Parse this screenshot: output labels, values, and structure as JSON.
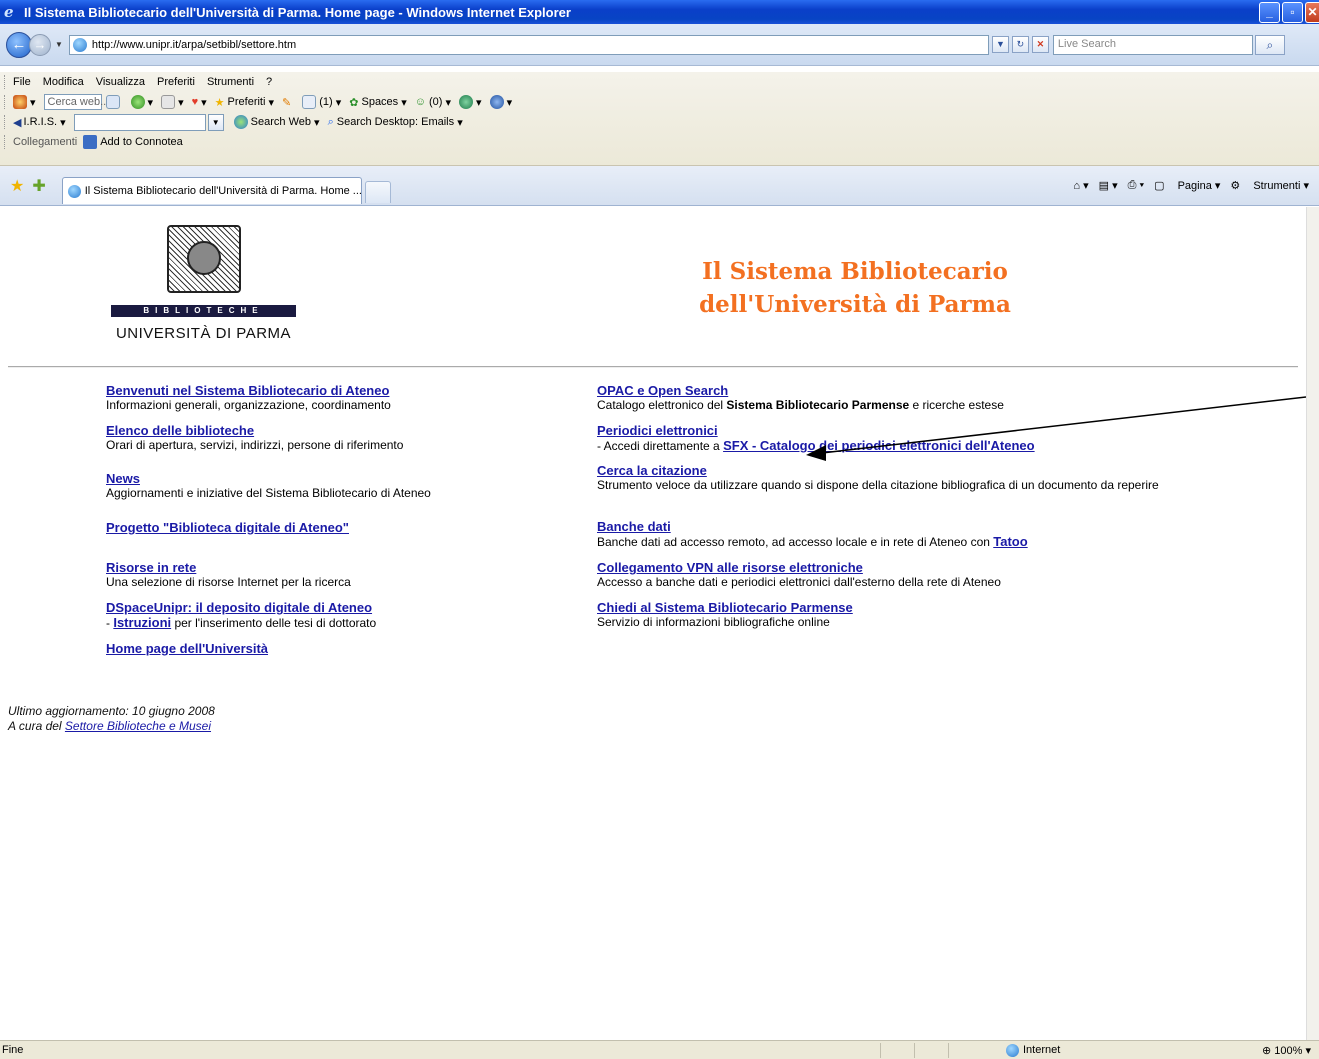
{
  "window": {
    "title": "Il Sistema Bibliotecario dell'Università di Parma. Home page - Windows Internet Explorer"
  },
  "address": {
    "url": "http://www.unipr.it/arpa/setbibl/settore.htm",
    "live_search_placeholder": "Live Search"
  },
  "menu": {
    "items": [
      "File",
      "Modifica",
      "Visualizza",
      "Preferiti",
      "Strumenti",
      "?"
    ]
  },
  "toolbar": {
    "cerca_placeholder": "Cerca web...",
    "preferiti": "Preferiti",
    "mail_count": "(1)",
    "spaces": "Spaces",
    "contacts_count": "(0)",
    "iris_label": "I.R.I.S.",
    "search_web": "Search Web",
    "search_desktop": "Search Desktop: Emails",
    "collegamenti": "Collegamenti",
    "add_to_connotea": "Add to Connotea"
  },
  "tabs": {
    "active_label": "Il Sistema Bibliotecario dell'Università di Parma. Home ...",
    "pagina": "Pagina",
    "strumenti": "Strumenti"
  },
  "page": {
    "logo_band": "BIBLIOTECHE",
    "logo_university": "UNIVERSITÀ DI PARMA",
    "title_line1": "Il Sistema Bibliotecario",
    "title_line2": "dell'Università di Parma",
    "left_column": [
      {
        "link": "Benvenuti nel Sistema Bibliotecario di Ateneo",
        "desc": "Informazioni generali, organizzazione, coordinamento"
      },
      {
        "link": "Elenco delle biblioteche",
        "desc": "Orari di apertura, servizi, indirizzi, persone di riferimento"
      },
      {
        "link": "News",
        "desc": "Aggiornamenti e iniziative del Sistema Bibliotecario di Ateneo"
      },
      {
        "link": "Progetto \"Biblioteca digitale di Ateneo\"",
        "desc": ""
      },
      {
        "link": "Risorse in rete",
        "desc": "Una selezione di risorse Internet per la ricerca"
      },
      {
        "link": "DSpaceUnipr: il deposito digitale di Ateneo",
        "desc_prefix": "- ",
        "desc_link": "Istruzioni",
        "desc": " per l'inserimento delle tesi di dottorato"
      },
      {
        "link": "Home page dell'Università",
        "desc": ""
      }
    ],
    "right_column": [
      {
        "link": "OPAC e Open Search",
        "desc_prefix": "Catalogo elettronico del ",
        "desc_bold": "Sistema Bibliotecario Parmense",
        "desc": " e ricerche estese"
      },
      {
        "link": "Periodici elettronici",
        "desc_prefix": "- Accedi direttamente a ",
        "desc_link": "SFX - Catalogo dei periodici elettronici dell'Ateneo"
      },
      {
        "link": "Cerca la citazione",
        "desc": "Strumento veloce da utilizzare quando si dispone della citazione bibliografica di un documento da reperire"
      },
      {
        "link": "Banche dati",
        "desc": "Banche dati ad accesso remoto, ad accesso locale e in rete di Ateneo con ",
        "desc_link": "Tatoo"
      },
      {
        "link": "Collegamento VPN alle risorse elettroniche",
        "desc": "Accesso a banche dati e periodici elettronici dall'esterno della rete di Ateneo"
      },
      {
        "link": "Chiedi al Sistema Bibliotecario Parmense",
        "desc": "Servizio di informazioni bibliografiche online"
      }
    ],
    "footer_updated": "Ultimo aggiornamento: 10 giugno 2008",
    "footer_curated_prefix": "A cura del ",
    "footer_curated_link": "Settore Biblioteche e Musei"
  },
  "status": {
    "text": "Fine",
    "zone": "Internet",
    "zoom": "100%"
  },
  "colors": {
    "title_orange": "#f37021",
    "link_blue": "#1a1aa6"
  }
}
